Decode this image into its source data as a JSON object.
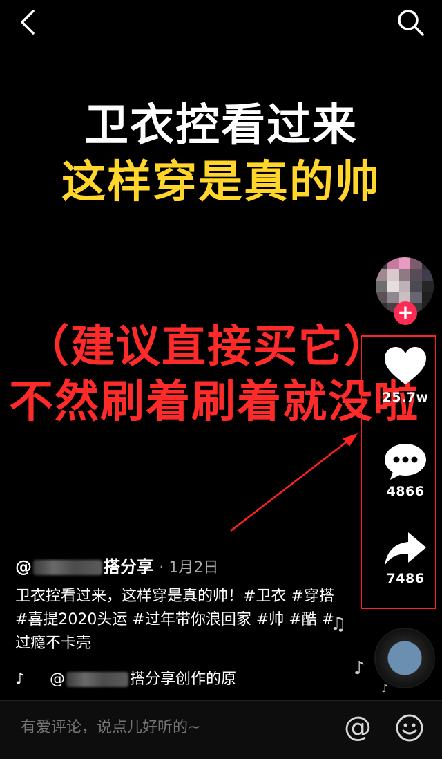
{
  "headline": {
    "line1": "卫衣控看过来",
    "line2": "这样穿是真的帅",
    "line3": "（建议直接买它）",
    "line4": "不然刷着刷着就没啦"
  },
  "actions": {
    "likes": "25.7w",
    "comments": "4866",
    "shares": "7486"
  },
  "author": {
    "prefix": "@",
    "name_suffix": "搭分享",
    "date": "· 1月2日"
  },
  "caption": "卫衣控看过来，这样穿是真的帅！#卫衣 #穿搭 #喜提2020头运 #过年带你浪回家 #帅 #酷 #过瘾不卡壳",
  "music": {
    "prefix": "@",
    "text": "搭分享创作的原"
  },
  "comment_box": {
    "placeholder": "有爱评论，说点儿好听的~"
  },
  "colors": {
    "headline_yellow": "#ffd629",
    "headline_red": "#ff2b2b",
    "follow_pink": "#fe2c55",
    "annotation_red": "#ff2222"
  }
}
